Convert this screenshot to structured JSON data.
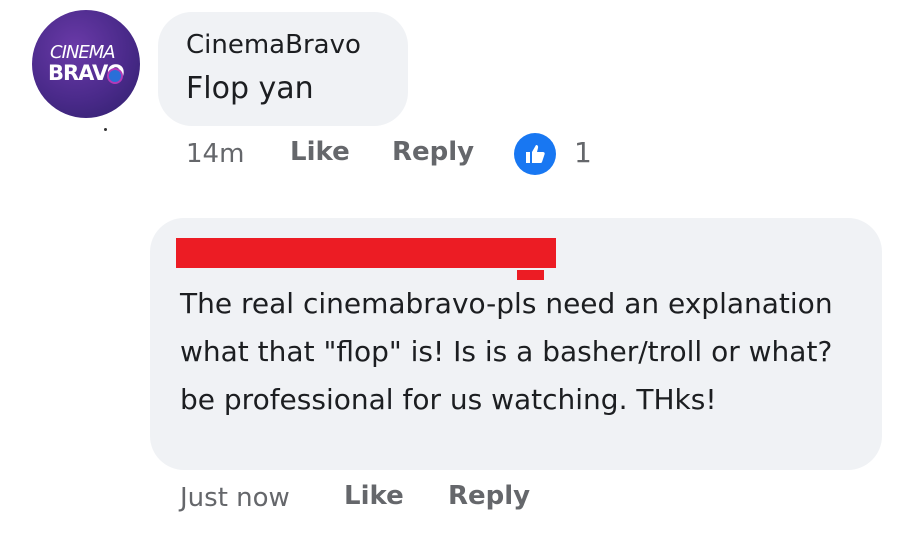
{
  "comments": [
    {
      "avatar": {
        "logo_line1": "CINEMA",
        "logo_line2": "BRAVO",
        "colors": [
          "#4a2a8a",
          "#2a6fd8",
          "#b23bb7"
        ]
      },
      "author": "CinemaBravo",
      "text": "Flop yan",
      "time": "14m",
      "like_label": "Like",
      "reply_label": "Reply",
      "reaction_icon": "thumbs-up-icon",
      "reaction_color": "#1877f2",
      "reaction_count": "1"
    },
    {
      "author_redacted": true,
      "redaction_color": "#ec1c24",
      "text": "The real cinemabravo-pls need an explanation what that \"flop\" is! Is is a basher/troll or what? be professional for us watching. THks!",
      "time": "Just now",
      "like_label": "Like",
      "reply_label": "Reply"
    }
  ],
  "colors": {
    "bubble_bg": "#f0f2f5",
    "text": "#1c1e21",
    "meta_text": "#65676b"
  }
}
